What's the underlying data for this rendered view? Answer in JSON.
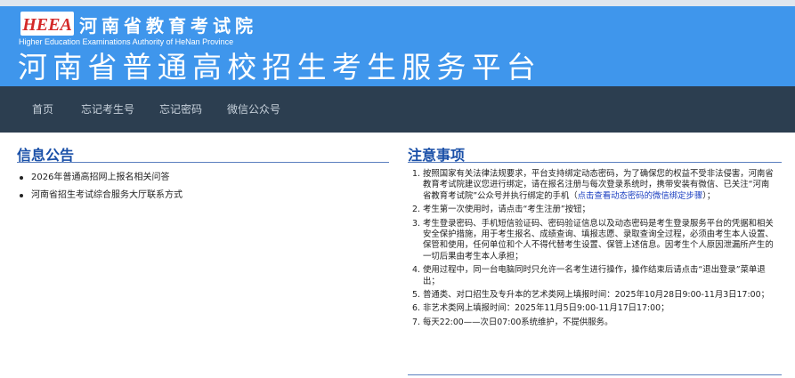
{
  "header": {
    "logo_text": "HEEA",
    "org_name": "河南省教育考试院",
    "org_name_en": "Higher Education Examinations Authority of HeNan Province",
    "platform_title": "河南省普通高校招生考生服务平台"
  },
  "nav": {
    "items": [
      {
        "label": "首页"
      },
      {
        "label": "忘记考生号"
      },
      {
        "label": "忘记密码"
      },
      {
        "label": "微信公众号"
      }
    ]
  },
  "announcements": {
    "title": "信息公告",
    "items": [
      {
        "label": "2026年普通高招网上报名相关问答"
      },
      {
        "label": "河南省招生考试综合服务大厅联系方式"
      }
    ]
  },
  "notes": {
    "title": "注意事项",
    "items": [
      {
        "num": "1.",
        "text": "按照国家有关法律法规要求，平台支持绑定动态密码，为了确保您的权益不受非法侵害，河南省教育考试院建议您进行绑定，请在报名注册与每次登录系统时，携带安装有微信、已关注“河南省教育考试院”公众号并执行绑定的手机（",
        "link": "点击查看动态密码的微信绑定步骤",
        "suffix": "）；"
      },
      {
        "num": "2.",
        "text": "考生第一次使用时，请点击“考生注册”按钮；"
      },
      {
        "num": "3.",
        "text": "考生登录密码、手机短信验证码、密码验证信息以及动态密码是考生登录服务平台的凭据和相关安全保护措施，用于考生报名、成绩查询、填报志愿、录取查询全过程，必须由考生本人设置、保管和使用，任何单位和个人不得代替考生设置、保管上述信息。因考生个人原因泄漏所产生的一切后果由考生本人承担；"
      },
      {
        "num": "4.",
        "text": "使用过程中，同一台电脑同时只允许一名考生进行操作，操作结束后请点击“退出登录”菜单退出；"
      },
      {
        "num": "5.",
        "text": "普通类、对口招生及专升本的艺术类网上填报时间：2025年10月28日9:00-11月3日17:00；"
      },
      {
        "num": "6.",
        "text": "非艺术类网上填报时间：2025年11月5日9:00-11月17日17:00；"
      },
      {
        "num": "7.",
        "text": "每天22:00——次日07:00系统维护，不提供服务。"
      }
    ]
  },
  "colors": {
    "header_bg": "#3f96ec",
    "nav_bg": "#2c3e50",
    "section_title": "#1a50a8",
    "link": "#1a3ec0"
  }
}
